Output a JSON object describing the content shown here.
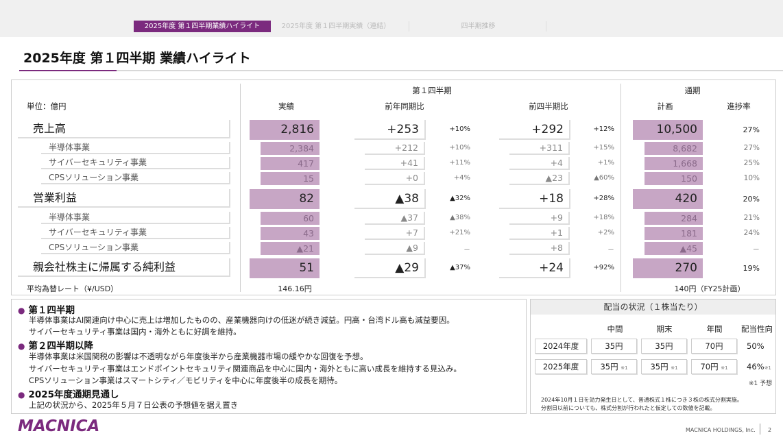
{
  "tabs": [
    "2025年度 第１四半期業績ハイライト",
    "2025年度 第１四半期実績（連結）",
    "四半期推移"
  ],
  "title": "2025年度 第１四半期 業績ハイライト",
  "table": {
    "group_q1": "第１四半期",
    "group_fy": "通期",
    "unit": "単位：億円",
    "col_actual": "実績",
    "col_yoy": "前年同期比",
    "col_qoq": "前四半期比",
    "col_plan": "計画",
    "col_progress": "進捗率",
    "rows": [
      {
        "label": "売上高",
        "actual": "2,816",
        "yoy": "+253",
        "yoy_pct": "+10%",
        "qoq": "+292",
        "qoq_pct": "+12%",
        "plan": "10,500",
        "progress": "27%"
      },
      {
        "label": "半導体事業",
        "actual": "2,384",
        "yoy": "+212",
        "yoy_pct": "+10%",
        "qoq": "+311",
        "qoq_pct": "+15%",
        "plan": "8,682",
        "progress": "27%"
      },
      {
        "label": "サイバーセキュリティ事業",
        "actual": "417",
        "yoy": "+41",
        "yoy_pct": "+11%",
        "qoq": "+4",
        "qoq_pct": "+1%",
        "plan": "1,668",
        "progress": "25%"
      },
      {
        "label": "CPSソリューション事業",
        "actual": "15",
        "yoy": "+0",
        "yoy_pct": "+4%",
        "qoq": "▲23",
        "qoq_pct": "▲60%",
        "plan": "150",
        "progress": "10%"
      },
      {
        "label": "営業利益",
        "actual": "82",
        "yoy": "▲38",
        "yoy_pct": "▲32%",
        "qoq": "+18",
        "qoq_pct": "+28%",
        "plan": "420",
        "progress": "20%"
      },
      {
        "label": "半導体事業",
        "actual": "60",
        "yoy": "▲37",
        "yoy_pct": "▲38%",
        "qoq": "+9",
        "qoq_pct": "+18%",
        "plan": "284",
        "progress": "21%"
      },
      {
        "label": "サイバーセキュリティ事業",
        "actual": "43",
        "yoy": "+7",
        "yoy_pct": "+21%",
        "qoq": "+1",
        "qoq_pct": "+2%",
        "plan": "181",
        "progress": "24%"
      },
      {
        "label": "CPSソリューション事業",
        "actual": "▲21",
        "yoy": "▲9",
        "yoy_pct": "－",
        "qoq": "+8",
        "qoq_pct": "－",
        "plan": "▲45",
        "progress": "－"
      },
      {
        "label": "親会社株主に帰属する純利益",
        "actual": "51",
        "yoy": "▲29",
        "yoy_pct": "▲37%",
        "qoq": "+24",
        "qoq_pct": "+92%",
        "plan": "270",
        "progress": "19%"
      }
    ],
    "fx_label": "平均為替レート（¥/USD）",
    "fx_actual": "146.16円",
    "fx_plan": "140円（FY25計画）"
  },
  "comments": {
    "h1": "第１四半期",
    "b1": "半導体事業はAI関連向け中心に売上は増加したものの、産業機器向けの低迷が続き減益。円高・台湾ドル高も減益要因。",
    "b2": "サイバーセキュリティ事業は国内・海外ともに好調を維持。",
    "h2": "第２四半期以降",
    "b3": "半導体事業は米国関税の影響は不透明ながら年度後半から産業機器市場の緩やかな回復を予想。",
    "b4": "サイバーセキュリティ事業はエンドポイントセキュリティ関連商品を中心に国内・海外ともに高い成長を維持する見込み。",
    "b5": "CPSソリューション事業はスマートシティ／モビリティを中心に年度後半の成長を期待。",
    "h3": "2025年度通期見通し",
    "b6": "上記の状況から、2025年５月７日公表の予想値を据え置き"
  },
  "dividend": {
    "title": "配当の状況（１株当たり）",
    "col_mid": "中間",
    "col_end": "期末",
    "col_year": "年間",
    "col_payout": "配当性向",
    "y2024": "2024年度",
    "y2024_mid": "35円",
    "y2024_end": "35円",
    "y2024_year": "70円",
    "y2024_payout": "50%",
    "y2025": "2025年度",
    "y2025_mid": "35円",
    "y2025_end": "35円",
    "y2025_year": "70円",
    "y2025_payout": "46%",
    "mark": "※1",
    "forecast_note": "※1 予想",
    "note1": "2024年10月１日を効力発生日として、普通株式１株につき３株の株式分割実施。",
    "note2": "分割日以前についても、株式分割が行われたと仮定しての数値を記載。"
  },
  "footer": {
    "logo": "MACNICA",
    "company": "MACNICA HOLDINGS, Inc.",
    "page": "2"
  }
}
